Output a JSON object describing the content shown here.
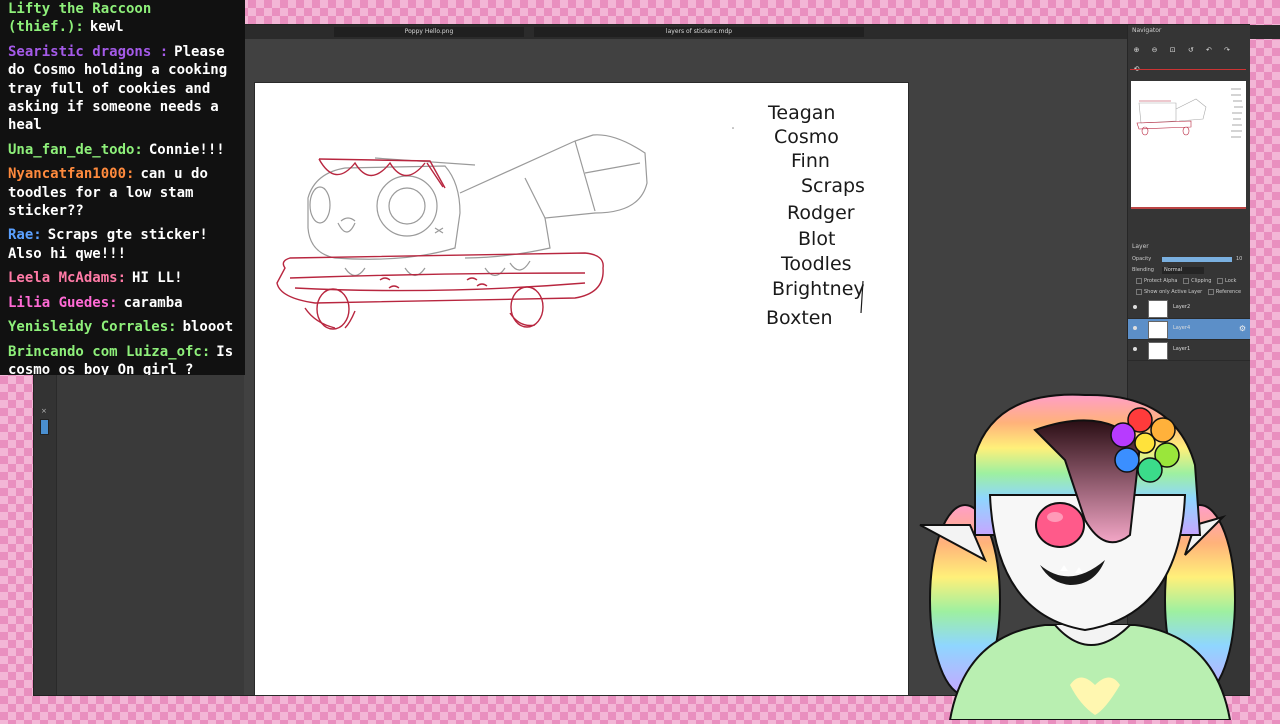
{
  "chat": {
    "messages": [
      {
        "user": "Lifty the Raccoon (thief.):",
        "text": "kewl",
        "color": "#8ef07a"
      },
      {
        "user": "Searistic dragons :",
        "text": "Please do Cosmo holding a cooking tray full of cookies and asking if someone needs a heal",
        "color": "#a45ae8"
      },
      {
        "user": "Una_fan_de_todo:",
        "text": "Connie!!!",
        "color": "#8ef07a"
      },
      {
        "user": "Nyancatfan1000:",
        "text": "can u do toodles for a low stam sticker??",
        "color": "#ff8a3d"
      },
      {
        "user": "Rae:",
        "text": "Scraps gte sticker! Also hi qwe!!!",
        "color": "#5aa0ff"
      },
      {
        "user": "Leela McAdams:",
        "text": "HI LL!",
        "color": "#ff7aa6"
      },
      {
        "user": "Lilia Guedes:",
        "text": "caramba",
        "color": "#ff6ad5"
      },
      {
        "user": "Yenisleidy Corrales:",
        "text": "blooot",
        "color": "#8ef07a"
      },
      {
        "user": "Brincando com Luiza_ofc:",
        "text": "Is cosmo os boy On girl ?",
        "color": "#8ef07a"
      }
    ]
  },
  "app": {
    "tabs": [
      "Poppy Hello.png",
      "layers of stickers.mdp"
    ],
    "toolbox": {
      "close_label": "×"
    }
  },
  "canvas": {
    "names": [
      "Teagan",
      "Cosmo",
      "Finn",
      "Scraps",
      "Rodger",
      "Blot",
      "Toodles",
      "Brightney",
      "Boxten"
    ]
  },
  "navigator": {
    "title": "Navigator",
    "tools": [
      "⊕",
      "⊖",
      "⊡",
      "↺",
      "↶",
      "↷",
      "⟲"
    ]
  },
  "layers": {
    "title": "Layer",
    "opacity_label": "Opacity",
    "opacity_value": "10",
    "opacity_level": 1.0,
    "blending_label": "Blending",
    "blending_value": "Normal",
    "options": [
      "Protect Alpha",
      "Clipping",
      "Lock"
    ],
    "options2": [
      "Show only Active Layer",
      "Reference"
    ],
    "items": [
      {
        "name": "Layer2",
        "active": false
      },
      {
        "name": "Layer4",
        "active": true
      },
      {
        "name": "Layer1",
        "active": false
      }
    ]
  }
}
